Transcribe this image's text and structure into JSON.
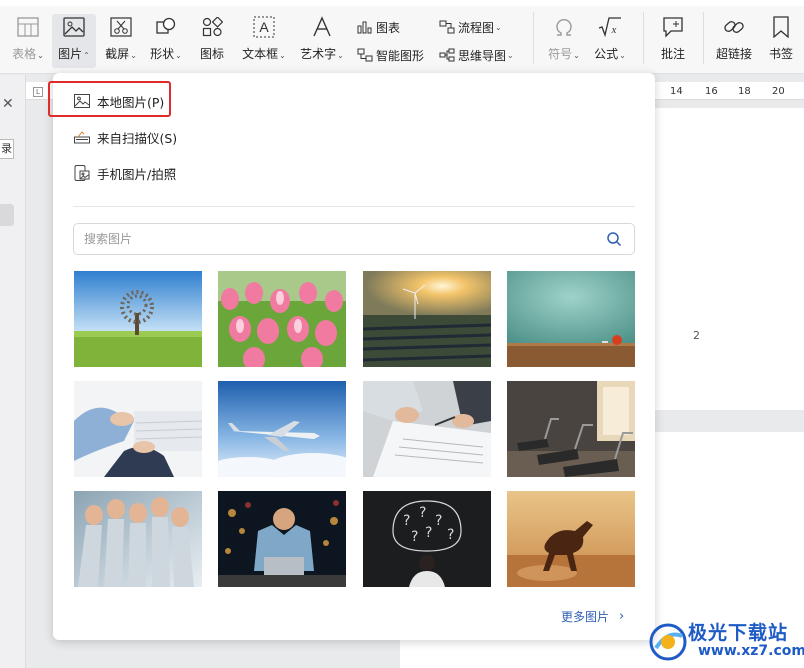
{
  "ribbon": {
    "tools": {
      "table": "表格",
      "picture": "图片",
      "screenshot": "截屏",
      "shape": "形状",
      "icon": "图标",
      "textbox": "文本框",
      "wordart": "艺术字",
      "chart": "图表",
      "smartart": "智能图形",
      "flowchart": "流程图",
      "mindmap": "思维导图",
      "symbol": "符号",
      "formula": "公式",
      "comment": "批注",
      "hyperlink": "超链接",
      "bookmark": "书签"
    }
  },
  "document": {
    "ruler_numbers": [
      "14",
      "16",
      "18",
      "20"
    ],
    "page_number": "2",
    "left_tab": "录"
  },
  "picture_menu": {
    "items": [
      {
        "label": "本地图片(P)",
        "icon": "local-image-icon"
      },
      {
        "label": "来自扫描仪(S)",
        "icon": "scanner-icon"
      },
      {
        "label": "手机图片/拍照",
        "icon": "phone-photo-icon"
      }
    ],
    "search_placeholder": "搜索图片",
    "more_label": "更多图片"
  },
  "thumbnails": [
    "tree-on-grass",
    "pink-tulips",
    "wind-turbine-solar-field",
    "apple-on-table",
    "business-hands-pen",
    "airplane-clouds",
    "document-signing",
    "gym-treadmills",
    "raised-fists",
    "cheering-man-laptop",
    "question-marks-chalkboard",
    "running-horse"
  ],
  "watermark": {
    "text": "极光下载站",
    "url": "www.xz7.com"
  },
  "colors": {
    "highlight_red": "#e02b2b",
    "link_blue": "#2f5fb5",
    "watermark_blue": "#1e5bc6"
  }
}
